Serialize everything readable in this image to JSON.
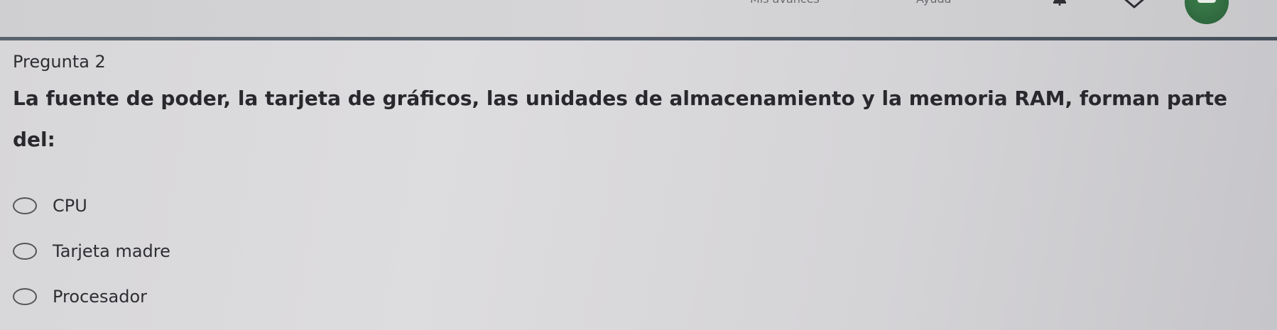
{
  "header": {
    "nav_items": [
      {
        "label": "Mis avances"
      },
      {
        "label": "Ayuda"
      }
    ],
    "icons": [
      "bell-icon",
      "chevron-down-icon",
      "avatar"
    ],
    "accent_color": "#2f6b3d",
    "divider_color": "#4e5966"
  },
  "question": {
    "label": "Pregunta 2",
    "text": "La fuente de poder, la tarjeta de gráficos, las unidades de almacenamiento y la memoria RAM, forman parte del:",
    "options": [
      {
        "label": "CPU",
        "selected": false
      },
      {
        "label": "Tarjeta madre",
        "selected": false
      },
      {
        "label": "Procesador",
        "selected": false
      }
    ]
  }
}
